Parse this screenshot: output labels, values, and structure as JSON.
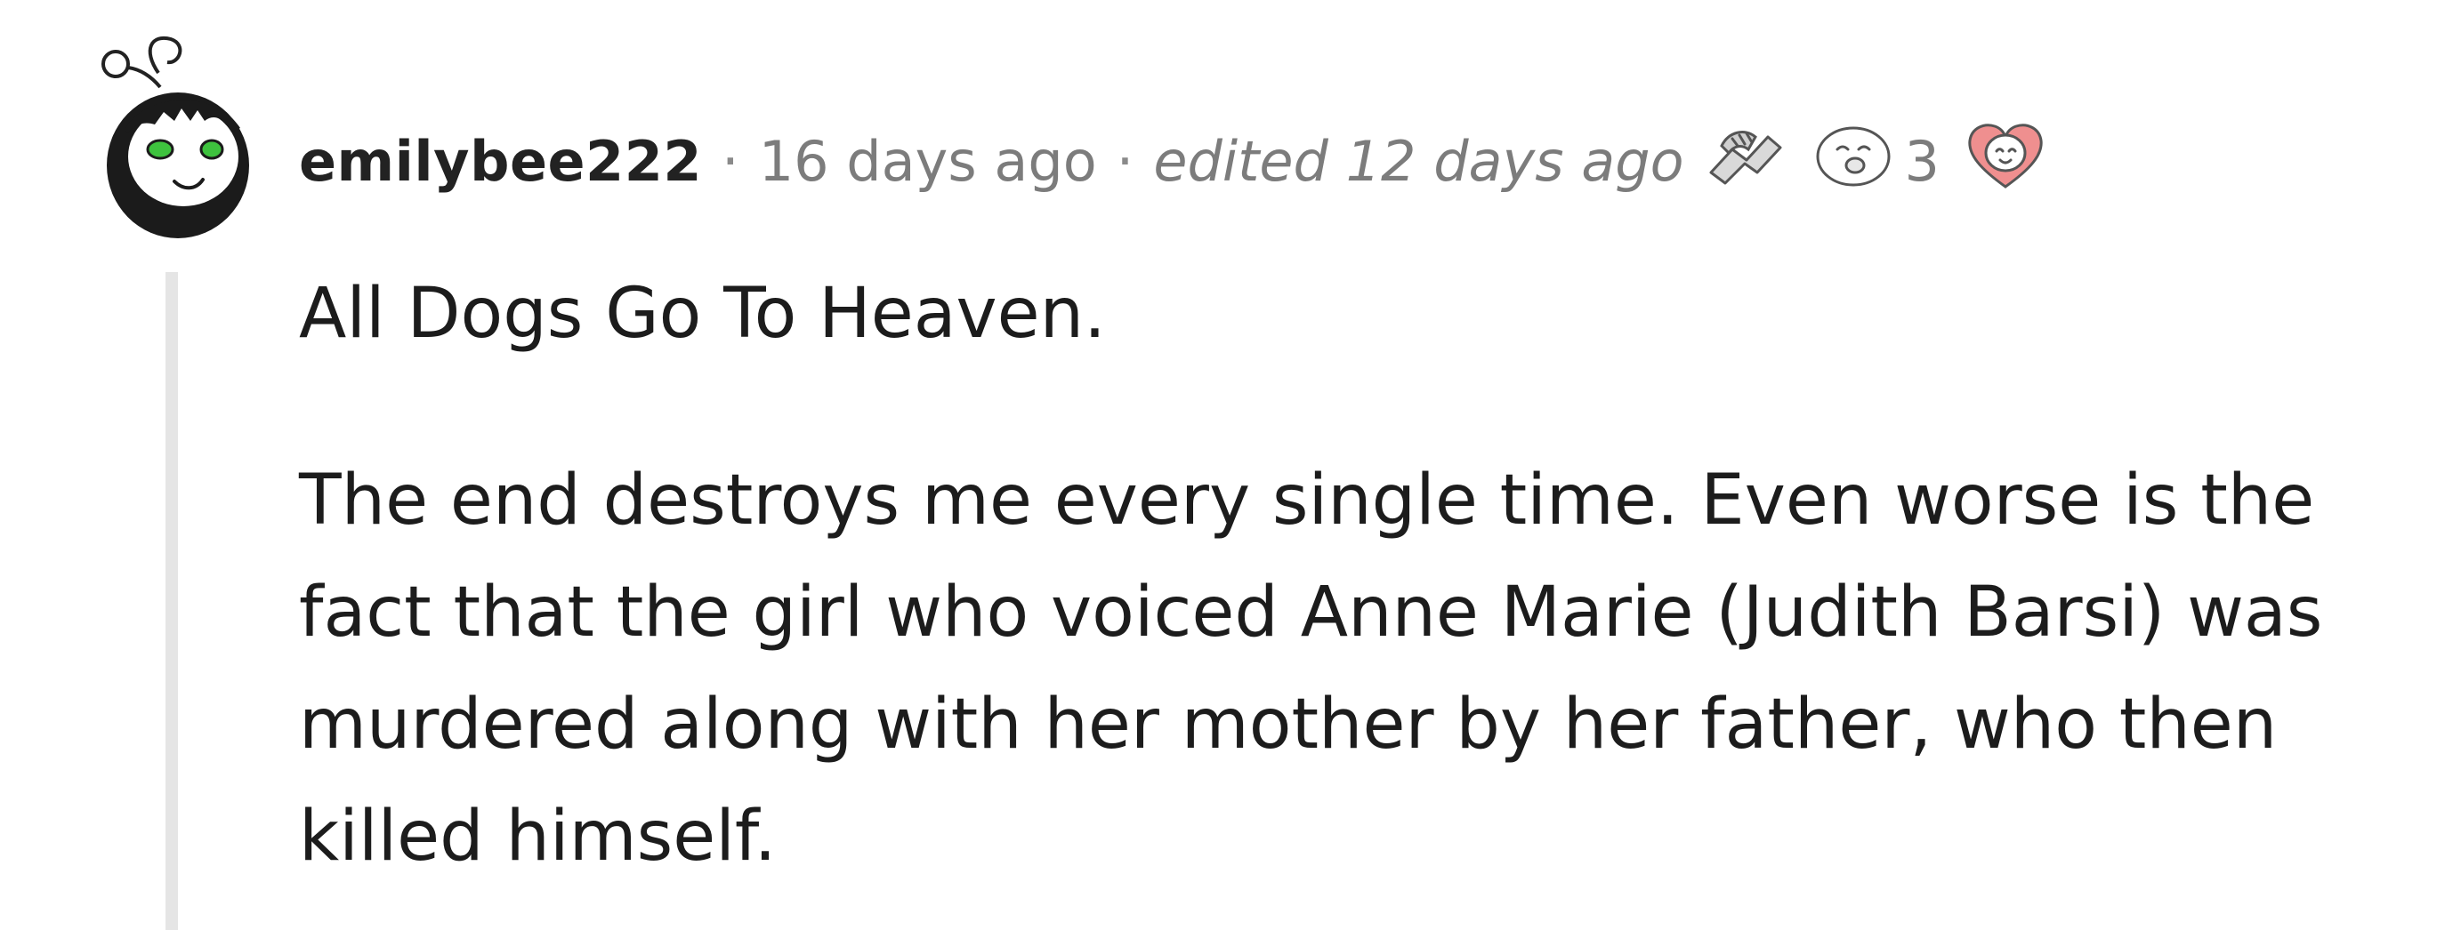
{
  "comment": {
    "author": "emilybee222",
    "separator": "·",
    "time_posted": "16 days ago",
    "edited": "edited 12 days ago",
    "awards": [
      {
        "icon": "handshake-award-icon",
        "count": ""
      },
      {
        "icon": "smiling-face-award-icon",
        "count": "3"
      },
      {
        "icon": "heart-face-award-icon",
        "count": ""
      }
    ],
    "paragraphs": [
      "All Dogs Go To Heaven.",
      "The end destroys me every single time. Even worse is the fact that the girl who voiced Anne Marie (Judith Barsi) was murdered along with her mother by her father, who then killed himself."
    ]
  }
}
